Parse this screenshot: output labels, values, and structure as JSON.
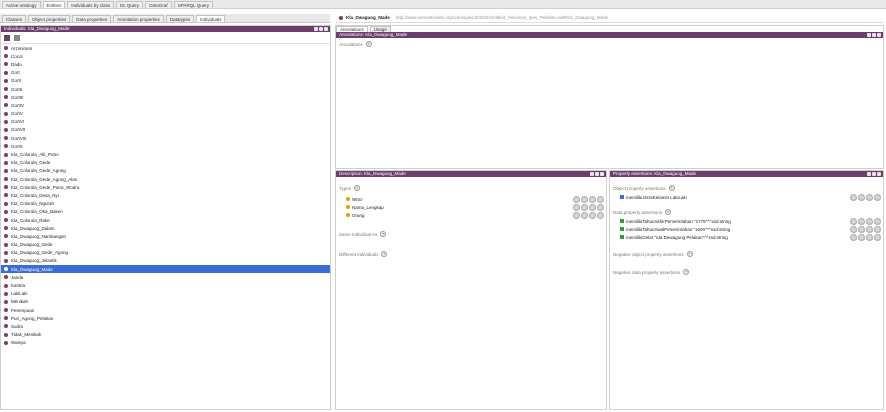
{
  "top_tabs": [
    "Active ontology",
    "Entities",
    "Individuals by class",
    "DL Query",
    "OntoGraf",
    "SPARQL Query"
  ],
  "sub_tabs": [
    "Classes",
    "Object properties",
    "Data properties",
    "Annotation properties",
    "Datatypes",
    "Individuals"
  ],
  "individuals_panel": {
    "title": "Individuals: Sla_Dwaguog_Made",
    "items": [
      "Arzimirans",
      "Cocol",
      "Dadu",
      "Gort",
      "GortI",
      "GortII",
      "GortIII",
      "GortIV",
      "GortV",
      "GortVI",
      "GortVII",
      "GortVIII",
      "GortX",
      "Kla_Colorola_Alit_Putro",
      "Kla_Colorola_Gede",
      "Kla_Colorola_Gede_Agong",
      "Kla_Colorola_Gede_Agong_Alas",
      "Kla_Colorola_Gede_Putra_Wodra",
      "Kla_Colorola_Desa_Nyi",
      "Kla_Colorola_Ngurah",
      "Kla_Colorola_Oka_Baken",
      "Kla_Colorola_Rake",
      "Kla_Dwaguog_Dalam",
      "Kla_Dwaguog_Nambangan",
      "Kla_Dwaguog_Gede",
      "Kla_Dwaguog_Gede_Agong",
      "Kla_Dwaguog_Jelantik",
      "Kla_Dwaguog_Made",
      "Janda",
      "Kastria",
      "LakiLaki",
      "Menikah",
      "Perempuan",
      "Puri_Agong_Pelakan",
      "Sudra",
      "Tidak_Menikah",
      "Waisya"
    ],
    "selected_index": 27
  },
  "entity_header": {
    "name": "Kla_Dwaguog_Made",
    "iri": "http://www.semanticweb.org/ontologies/2020/5/Untitled_Selvanya_Ipes_Pelakan.owl#Kla_Dwaguog_Made"
  },
  "entity_tabs": [
    "Annotations",
    "Usage"
  ],
  "annotations_panel": {
    "title": "Annotations: Kla_Dwaguog_Made",
    "label": "Annotations"
  },
  "description_panel": {
    "title": "Description: Kla_Dwaguog_Made",
    "types_label": "Types",
    "types": [
      "Wrtcr",
      "Nama_Lengkap",
      "Orang"
    ],
    "same_label": "Same Individual As",
    "different_label": "Different Individuals"
  },
  "property_panel": {
    "title": "Property assertions: Kla_Dwaguog_Made",
    "object_label": "Object property assertions",
    "object_items": [
      "memilikiJenisKelamin LakiLaki"
    ],
    "data_label": "Data property assertions",
    "data_items": [
      "memilikiTahunAkhirPemerintahan \"1775\"^^xsd:string",
      "memilikiTahunAwalPemerintahan \"1600\"^^xsd:string",
      "memilikiGelar \"Ida Dewagung Pelakan\"^^xsd:string"
    ],
    "neg_object_label": "Negative object property assertions",
    "neg_data_label": "Negative data property assertions"
  }
}
